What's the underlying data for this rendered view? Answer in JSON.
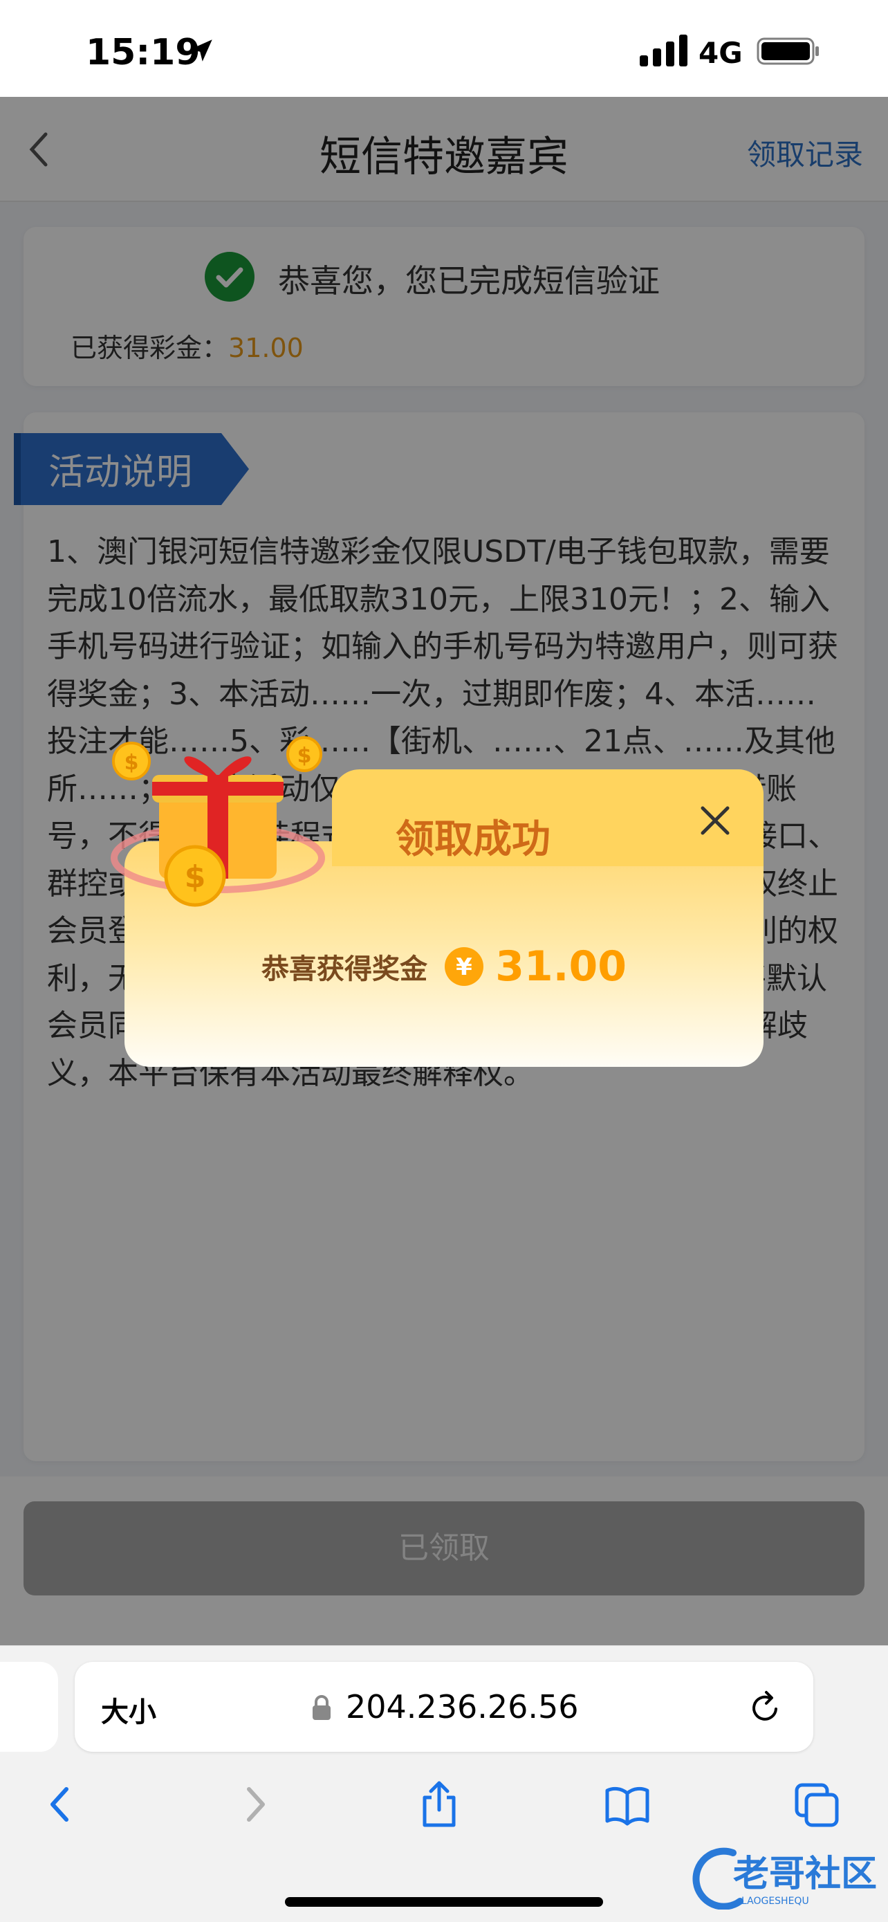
{
  "status_bar": {
    "time": "15:19",
    "network": "4G"
  },
  "nav": {
    "title": "短信特邀嘉宾",
    "records_link": "领取记录"
  },
  "verify_card": {
    "message": "恭喜您，您已完成短信验证",
    "bonus_label": "已获得彩金：",
    "bonus_value": "31.00"
  },
  "activity": {
    "tag": "活动说明",
    "rules_text": "1、澳门银河短信特邀彩金仅限USDT/电子钱包取款，需要完成10倍流水，最低取款310元，上限310元！；2、输入手机号码进行验证；如输入的手机号码为特邀用户，则可获得奖金；3、本活动……一次，过期即作废；4、本活……投注才能……5、彩……【街机、……、21点、……及其他所……；6、本活动仅限账号本人领取奖励，禁止租借账号，不得使用外挂程式、机器人、利用协议、漏洞、接口、群控或其他技术手段参与，一经查核属实，本平台有权终止会员登录、暂停会员使用网站、及没收奖金和不当盈利的权利，无需特别通知；7、会员参与该活动时，本平台将默认会员同意且遵守对应条件等相关规定，为避免文字理解歧义，本平台保有本活动最终解释权。"
  },
  "claim_button": {
    "label": "已领取"
  },
  "modal": {
    "title": "领取成功",
    "reward_label": "恭喜获得奖金",
    "currency_symbol": "¥",
    "reward_amount": "31.00"
  },
  "browser": {
    "text_size": "大小",
    "url": "204.236.26.56"
  },
  "watermark": {
    "text": "老哥社区",
    "subtext": "LAOGESHEQU"
  }
}
